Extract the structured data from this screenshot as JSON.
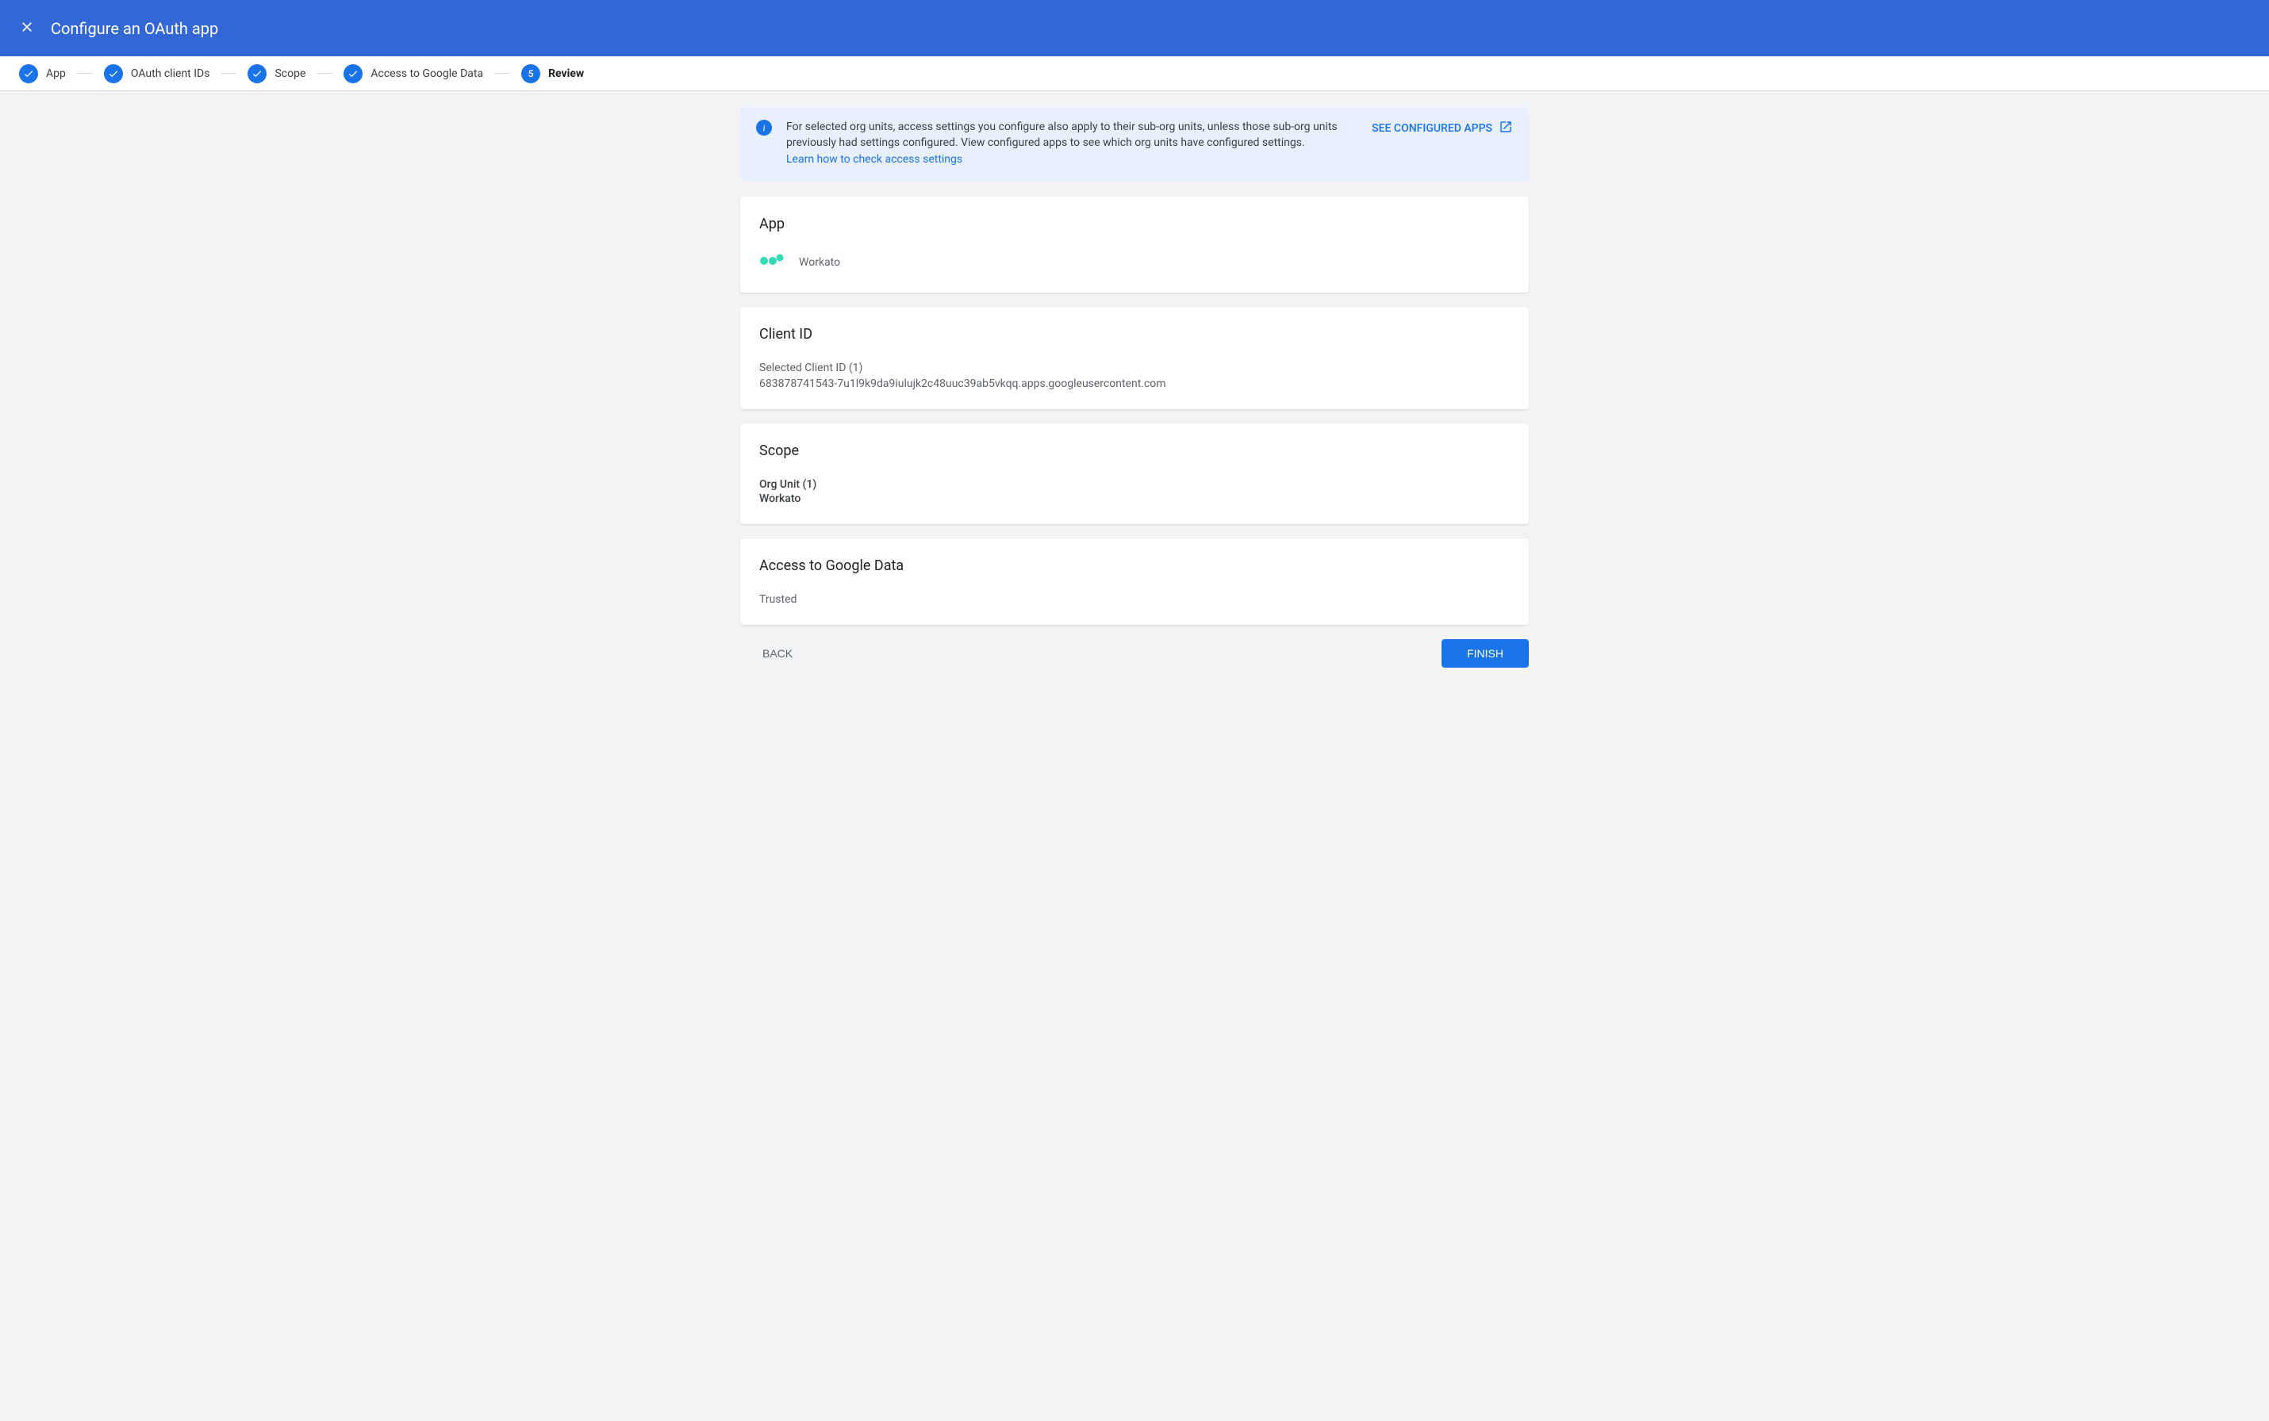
{
  "header": {
    "title": "Configure an OAuth app"
  },
  "stepper": {
    "steps": [
      {
        "label": "App",
        "completed": true
      },
      {
        "label": "OAuth client IDs",
        "completed": true
      },
      {
        "label": "Scope",
        "completed": true
      },
      {
        "label": "Access to Google Data",
        "completed": true
      },
      {
        "label": "Review",
        "number": "5",
        "active": true
      }
    ]
  },
  "info_banner": {
    "text": "For selected org units, access settings you configure also apply to their sub-org units, unless those sub-org units previously had settings configured. View configured apps to see which org units have configured settings.",
    "link_text": "Learn how to check access settings",
    "action_label": "SEE CONFIGURED APPS"
  },
  "cards": {
    "app": {
      "title": "App",
      "app_name": "Workato"
    },
    "client_id": {
      "title": "Client ID",
      "label": "Selected Client ID (1)",
      "value": "683878741543-7u1l9k9da9iulujk2c48uuc39ab5vkqq.apps.googleusercontent.com"
    },
    "scope": {
      "title": "Scope",
      "org_unit_label": "Org Unit (1)",
      "org_unit_value": "Workato"
    },
    "access": {
      "title": "Access to Google Data",
      "value": "Trusted"
    }
  },
  "footer": {
    "back_label": "BACK",
    "finish_label": "FINISH"
  }
}
